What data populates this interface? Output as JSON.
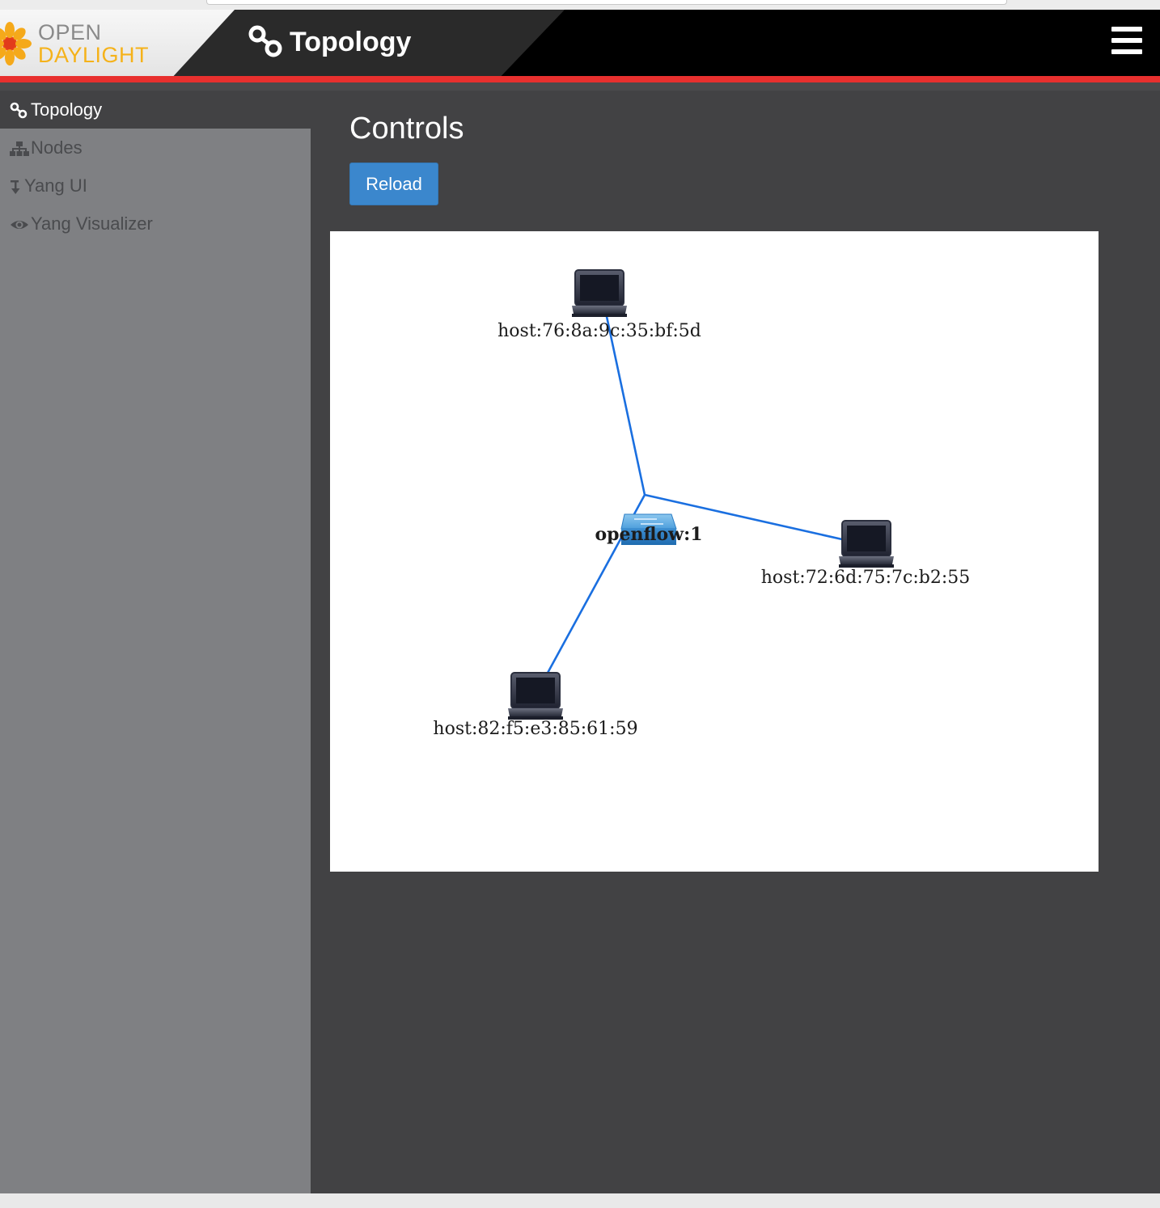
{
  "app": {
    "logo": {
      "line1": "OPEN",
      "line2": "DAYLIGHT"
    },
    "page_title": "Topology",
    "menu_icon": "hamburger-icon"
  },
  "colors": {
    "header_bg": "#000000",
    "accent_red": "#e8302e",
    "sidebar_bg": "#7f8083",
    "content_bg": "#424244",
    "button_blue": "#3b87cd",
    "link_blue": "#1a6fe0",
    "logo_orange": "#f5b21a"
  },
  "sidebar": {
    "items": [
      {
        "label": "Topology",
        "icon": "topology-icon",
        "active": true
      },
      {
        "label": "Nodes",
        "icon": "sitemap-icon",
        "active": false
      },
      {
        "label": "Yang UI",
        "icon": "arrow-down-icon",
        "active": false
      },
      {
        "label": "Yang Visualizer",
        "icon": "eye-icon",
        "active": false
      }
    ]
  },
  "main": {
    "title": "Controls",
    "reload_label": "Reload"
  },
  "topology": {
    "nodes": [
      {
        "id": "openflow:1",
        "label": "openflow:1",
        "type": "switch"
      },
      {
        "id": "host:76:8a:9c:35:bf:5d",
        "label": "host:76:8a:9c:35:bf:5d",
        "type": "host"
      },
      {
        "id": "host:72:6d:75:7c:b2:55",
        "label": "host:72:6d:75:7c:b2:55",
        "type": "host"
      },
      {
        "id": "host:82:f5:e3:85:61:59",
        "label": "host:82:f5:e3:85:61:59",
        "type": "host"
      }
    ],
    "links": [
      {
        "source": "openflow:1",
        "target": "host:76:8a:9c:35:bf:5d"
      },
      {
        "source": "openflow:1",
        "target": "host:72:6d:75:7c:b2:55"
      },
      {
        "source": "openflow:1",
        "target": "host:82:f5:e3:85:61:59"
      }
    ]
  }
}
